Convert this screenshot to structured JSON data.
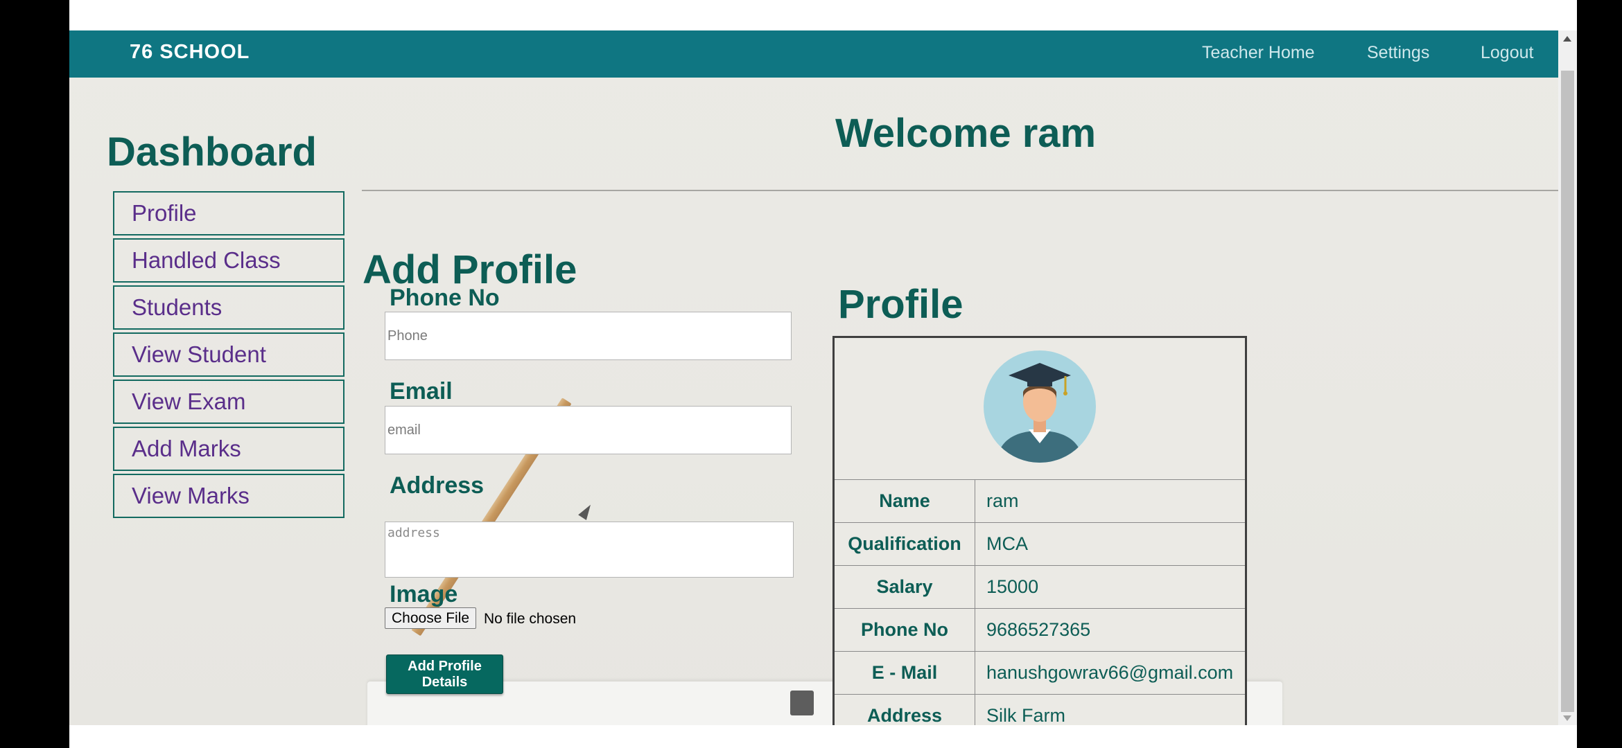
{
  "navbar": {
    "brand": "76 SCHOOL",
    "links": [
      "Teacher Home",
      "Settings",
      "Logout"
    ]
  },
  "sidebar": {
    "title": "Dashboard",
    "items": [
      "Profile",
      "Handled Class",
      "Students",
      "View Student",
      "View Exam",
      "Add Marks",
      "View Marks"
    ]
  },
  "welcome": "Welcome ram",
  "form": {
    "title": "Add Profile",
    "phone": {
      "label": "Phone No",
      "placeholder": "Phone",
      "value": ""
    },
    "email": {
      "label": "Email",
      "placeholder": "email",
      "value": ""
    },
    "address": {
      "label": "Address",
      "placeholder": "address",
      "value": ""
    },
    "image": {
      "label": "Image",
      "button": "Choose File",
      "status": "No file chosen"
    },
    "submit": "Add Profile Details"
  },
  "profile": {
    "title": "Profile",
    "avatar_icon": "graduate-avatar-icon",
    "rows": [
      {
        "key": "Name",
        "value": "ram"
      },
      {
        "key": "Qualification",
        "value": "MCA"
      },
      {
        "key": "Salary",
        "value": "15000"
      },
      {
        "key": "Phone No",
        "value": "9686527365"
      },
      {
        "key": "E - Mail",
        "value": "hanushgowrav66@gmail.com"
      },
      {
        "key": "Address",
        "value": "Silk Farm"
      }
    ]
  },
  "colors": {
    "navbar": "#0f7682",
    "heading": "#0d5d55",
    "menu_text": "#5a2e8a",
    "button": "#06685f"
  }
}
